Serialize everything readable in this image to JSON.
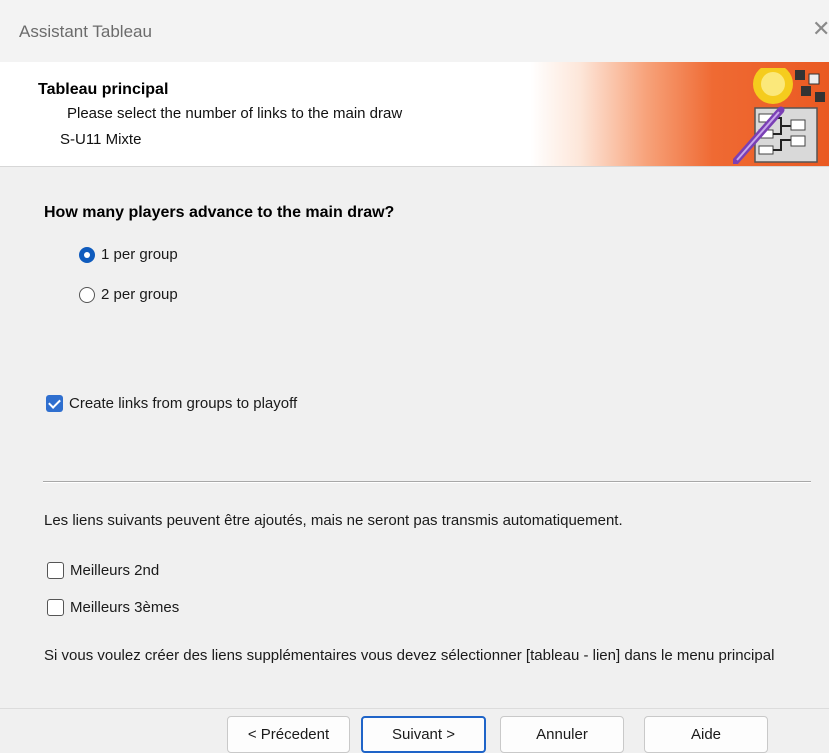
{
  "window": {
    "title": "Assistant Tableau",
    "close_glyph": "✕"
  },
  "header": {
    "title": "Tableau principal",
    "subtitle": "Please select the number of links to the main draw",
    "event": "S-U11 Mixte",
    "logo_icon": "draw-bracket-wand-icon"
  },
  "question": {
    "label": "How many players advance to the main draw?",
    "options": [
      {
        "label": "1 per group",
        "selected": true
      },
      {
        "label": "2 per group",
        "selected": false
      }
    ]
  },
  "create_links": {
    "label": "Create links from groups to playoff",
    "checked": true
  },
  "info_text": "Les liens suivants peuvent être ajoutés, mais ne seront pas transmis automatiquement.",
  "extra_links": [
    {
      "label": "Meilleurs 2nd",
      "checked": false
    },
    {
      "label": "Meilleurs 3èmes",
      "checked": false
    }
  ],
  "hint_text": "Si vous voulez créer des liens supplémentaires vous devez sélectionner [tableau - lien] dans le menu principal",
  "buttons": {
    "previous": "< Précedent",
    "next": "Suivant >",
    "cancel": "Annuler",
    "help": "Aide"
  },
  "colors": {
    "accent": "#0f5bbd",
    "header_gradient_end": "#ea5a22",
    "background": "#f0f0f0"
  }
}
